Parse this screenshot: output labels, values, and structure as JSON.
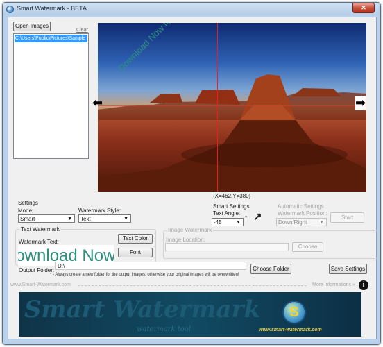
{
  "window": {
    "title": "Smart Watermark - BETA",
    "close_glyph": "✕"
  },
  "file_panel": {
    "open_label": "Open Images",
    "clear_label": "Clear",
    "files": [
      "C:\\Users\\Public\\Pictures\\Sample Pic"
    ]
  },
  "preview": {
    "watermark_text": "Download Now for FREE",
    "coord_text": "{X=462,Y=380}",
    "prev_arrow": "⬅",
    "next_arrow": "➡"
  },
  "settings": {
    "heading": "Settings",
    "mode_label": "Mode:",
    "mode_value": "Smart",
    "style_label": "Watermark Style:",
    "style_value": "Text",
    "smart_heading": "Smart Settings",
    "angle_label": "Text Angle:",
    "angle_value": "-45",
    "angle_unit": "°",
    "auto_heading": "Automatic Settings",
    "position_label": "Watermark Position:",
    "position_value": "Down/Right",
    "start_label": "Start"
  },
  "text_watermark": {
    "group_title": "Text Watermark",
    "text_label": "Watermark Text:",
    "text_value": "Download Now for FREE",
    "color_button": "Text Color",
    "font_button": "Font"
  },
  "image_watermark": {
    "group_title": "Image Watermark",
    "location_label": "Image Location:",
    "choose_label": "Choose"
  },
  "output": {
    "label": "Output Folder:",
    "path": "D:\\",
    "note": "* - Always create a new folder for the output images, otherwise your original images will be overwritten!",
    "choose_folder": "Choose Folder",
    "save_settings": "Save Settings"
  },
  "footer": {
    "site": "www.Smart-Watermark.com",
    "more_info": "More informations »",
    "info_glyph": "i"
  },
  "banner": {
    "title": "Smart Watermark",
    "subtitle": "watermark tool",
    "url": "www.smart-watermark.com",
    "logo_letter": "S"
  }
}
